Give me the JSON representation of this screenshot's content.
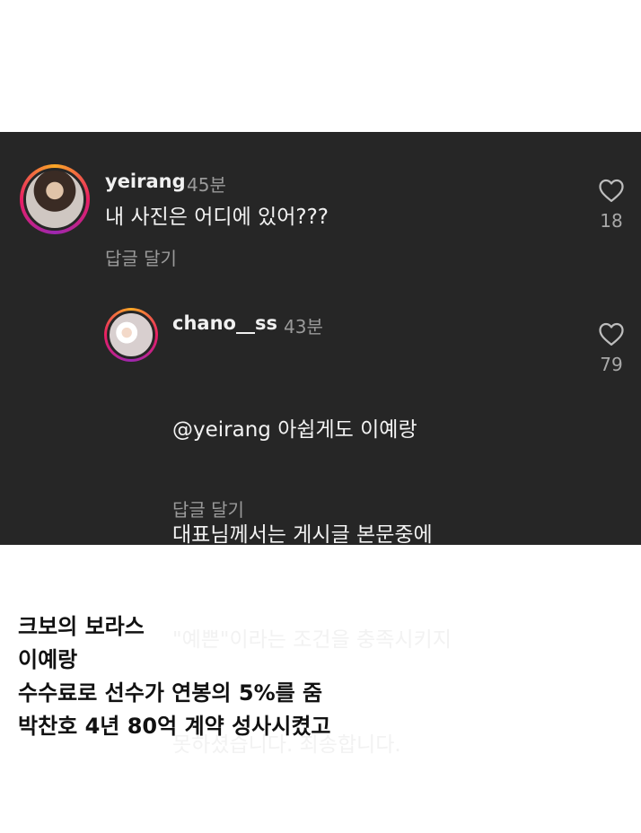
{
  "comment": {
    "username": "yeirang",
    "time": "45분",
    "text": "내 사진은 어디에 있어???",
    "reply_label": "답글 달기",
    "likes": "18",
    "like_icon": "heart-outline-icon"
  },
  "reply": {
    "username": "chano__ss",
    "time": "43분",
    "lines": [
      "@yeirang 아쉽게도 이예랑",
      "대표님께서는 게시글 본문중에",
      "\"예쁜\"이라는 조건을 충족시키지",
      "못하셨습니다. 죄송합니다."
    ],
    "reply_label": "답글 달기",
    "likes": "79",
    "like_icon": "heart-outline-icon"
  },
  "caption": {
    "lines": [
      "크보의 보라스",
      "이예랑",
      "수수료로 선수가 연봉의 5%를 줌",
      "박찬호 4년 80억 계약 성사시켰고"
    ]
  },
  "colors": {
    "panel_bg": "#262626",
    "ring_start": "#f9a825",
    "ring_end": "#9c27b0"
  }
}
